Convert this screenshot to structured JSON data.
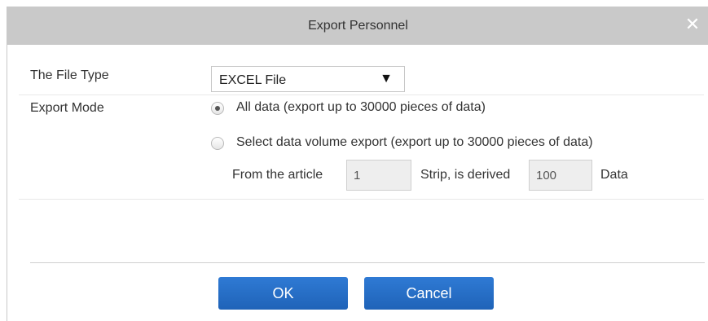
{
  "dialog": {
    "title": "Export Personnel",
    "close_glyph": "✕"
  },
  "file_type": {
    "label": "The File Type",
    "selected": "EXCEL File",
    "arrow": "▼"
  },
  "export_mode": {
    "label": "Export Mode",
    "option_all": {
      "label": "All data (export up to 30000 pieces of data)",
      "checked": true
    },
    "option_select": {
      "label": "Select data volume export (export up to 30000 pieces of data)",
      "checked": false
    },
    "range": {
      "from_label": "From the article",
      "from_value": "1",
      "strip_label": "Strip, is derived",
      "count_value": "100",
      "data_label": "Data"
    }
  },
  "buttons": {
    "ok": "OK",
    "cancel": "Cancel"
  },
  "colors": {
    "titlebar": "#c9c9c9",
    "button": "#2a72cc"
  }
}
